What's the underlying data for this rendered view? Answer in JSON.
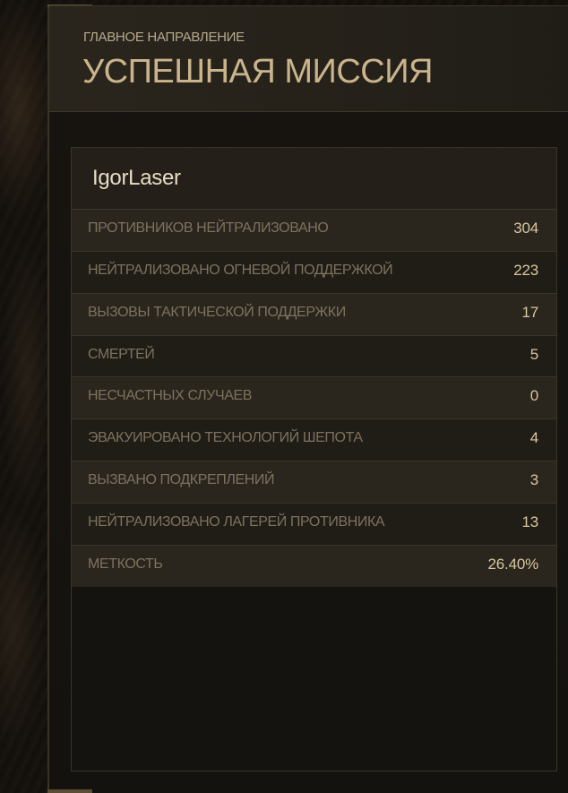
{
  "header": {
    "subtitle": "ГЛАВНОЕ НАПРАВЛЕНИЕ",
    "title": "УСПЕШНАЯ МИССИЯ"
  },
  "player": {
    "name": "IgorLaser"
  },
  "stats": [
    {
      "label": "ПРОТИВНИКОВ НЕЙТРАЛИЗОВАНО",
      "value": "304"
    },
    {
      "label": "НЕЙТРАЛИЗОВАНО ОГНЕВОЙ ПОДДЕРЖКОЙ",
      "value": "223"
    },
    {
      "label": "ВЫЗОВЫ ТАКТИЧЕСКОЙ ПОДДЕРЖКИ",
      "value": "17"
    },
    {
      "label": "СМЕРТЕЙ",
      "value": "5"
    },
    {
      "label": "НЕСЧАСТНЫХ СЛУЧАЕВ",
      "value": "0"
    },
    {
      "label": "ЭВАКУИРОВАНО ТЕХНОЛОГИЙ ШЕПОТА",
      "value": "4"
    },
    {
      "label": "ВЫЗВАНО ПОДКРЕПЛЕНИЙ",
      "value": "3"
    },
    {
      "label": "НЕЙТРАЛИЗОВАНО ЛАГЕРЕЙ ПРОТИВНИКА",
      "value": "13"
    },
    {
      "label": "МЕТКОСТЬ",
      "value": "26.40%"
    }
  ],
  "colors": {
    "accent": "#c9b48c",
    "label": "#7d725e",
    "value": "#d8c69f"
  }
}
